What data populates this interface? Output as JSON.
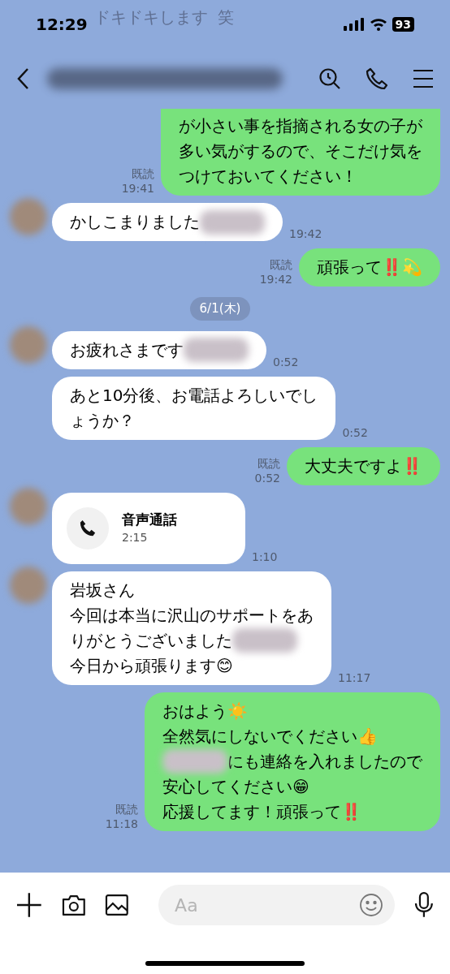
{
  "ghost_text": [
    "ドキドキします",
    "笑"
  ],
  "status_bar": {
    "time": "12:29",
    "battery": "93"
  },
  "header": {
    "title_blurred": true
  },
  "messages": [
    {
      "kind": "sent",
      "read": "既読",
      "time": "19:41",
      "clipped_top": true,
      "lines": [
        [
          {
            "kind": "text",
            "text": "が小さい事を指摘される女の子が"
          }
        ],
        [
          {
            "kind": "text",
            "text": "多い気がするので、そこだけ気を"
          }
        ],
        [
          {
            "kind": "text",
            "text": "つけておいてください！"
          }
        ]
      ]
    },
    {
      "kind": "received",
      "avatar": true,
      "time": "19:42",
      "lines": [
        [
          {
            "kind": "text",
            "text": "かしこまりました"
          },
          {
            "kind": "blur"
          }
        ]
      ]
    },
    {
      "kind": "sent",
      "read": "既読",
      "time": "19:42",
      "lines": [
        [
          {
            "kind": "text",
            "text": "頑張って‼️💫"
          }
        ]
      ]
    },
    {
      "kind": "date",
      "label": "6/1(木)"
    },
    {
      "kind": "received",
      "avatar": true,
      "time": "0:52",
      "lines": [
        [
          {
            "kind": "text",
            "text": "お疲れさまです"
          },
          {
            "kind": "blur"
          }
        ]
      ]
    },
    {
      "kind": "received",
      "avatar": false,
      "time": "0:52",
      "lines": [
        [
          {
            "kind": "text",
            "text": "あと10分後、お電話よろしいでし"
          }
        ],
        [
          {
            "kind": "text",
            "text": "ょうか？"
          }
        ]
      ]
    },
    {
      "kind": "sent",
      "read": "既読",
      "time": "0:52",
      "lines": [
        [
          {
            "kind": "text",
            "text": "大丈夫ですよ‼️"
          }
        ]
      ]
    },
    {
      "kind": "call",
      "avatar": true,
      "time": "1:10",
      "title": "音声通話",
      "duration": "2:15"
    },
    {
      "kind": "received",
      "avatar": true,
      "time": "11:17",
      "lines": [
        [
          {
            "kind": "text",
            "text": "岩坂さん"
          }
        ],
        [
          {
            "kind": "text",
            "text": "今回は本当に沢山のサポートをあ"
          }
        ],
        [
          {
            "kind": "text",
            "text": "りがとうございました"
          },
          {
            "kind": "blur"
          }
        ],
        [
          {
            "kind": "text",
            "text": "今日から頑張ります😊"
          }
        ]
      ]
    },
    {
      "kind": "sent",
      "read": "既読",
      "time": "11:18",
      "lines": [
        [
          {
            "kind": "text",
            "text": "おはよう☀️"
          }
        ],
        [
          {
            "kind": "text",
            "text": "全然気にしないでください👍"
          }
        ],
        [
          {
            "kind": "blur"
          },
          {
            "kind": "text",
            "text": "にも連絡を入れましたので"
          }
        ],
        [
          {
            "kind": "text",
            "text": "安心してください😁"
          }
        ],
        [
          {
            "kind": "text",
            "text": "応援してます！頑張って‼️"
          }
        ]
      ]
    }
  ],
  "composer": {
    "placeholder": "Aa"
  }
}
